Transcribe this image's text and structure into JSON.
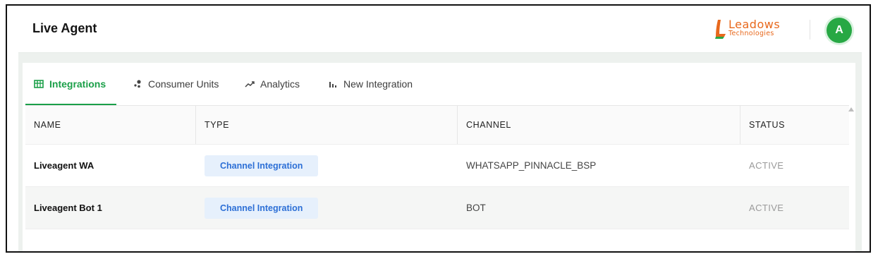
{
  "app": {
    "title": "Live Agent"
  },
  "brand": {
    "name": "Leadows",
    "sub": "Technologies",
    "color": "#e8681c"
  },
  "user": {
    "avatar_letter": "A"
  },
  "tabs": [
    {
      "label": "Integrations",
      "icon": "table-icon",
      "active": true
    },
    {
      "label": "Consumer Units",
      "icon": "users-icon",
      "active": false
    },
    {
      "label": "Analytics",
      "icon": "trend-icon",
      "active": false
    },
    {
      "label": "New Integration",
      "icon": "bar-chart-icon",
      "active": false
    }
  ],
  "table": {
    "columns": [
      "NAME",
      "TYPE",
      "CHANNEL",
      "STATUS"
    ],
    "rows": [
      {
        "name": "Liveagent WA",
        "type": "Channel Integration",
        "channel": "WHATSAPP_PINNACLE_BSP",
        "status": "ACTIVE"
      },
      {
        "name": "Liveagent Bot 1",
        "type": "Channel Integration",
        "channel": "BOT",
        "status": "ACTIVE"
      }
    ]
  },
  "colors": {
    "accent": "#1a9f48",
    "pill_bg": "#e6f0fc",
    "pill_text": "#2c6fd6"
  }
}
